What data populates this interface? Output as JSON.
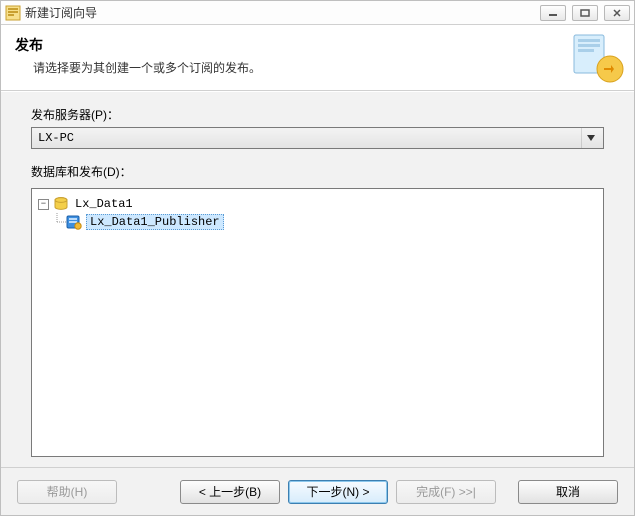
{
  "window": {
    "title": "新建订阅向导"
  },
  "header": {
    "title": "发布",
    "description": "请选择要为其创建一个或多个订阅的发布。"
  },
  "publisher": {
    "label": "发布服务器(P)：",
    "value": "LX-PC"
  },
  "databases": {
    "label": "数据库和发布(D)：",
    "items": [
      {
        "name": "Lx_Data1",
        "expanded": true,
        "children": [
          {
            "name": "Lx_Data1_Publisher",
            "selected": true
          }
        ]
      }
    ]
  },
  "buttons": {
    "help": "帮助(H)",
    "back": "< 上一步(B)",
    "next": "下一步(N) >",
    "finish": "完成(F) >>|",
    "cancel": "取消"
  }
}
